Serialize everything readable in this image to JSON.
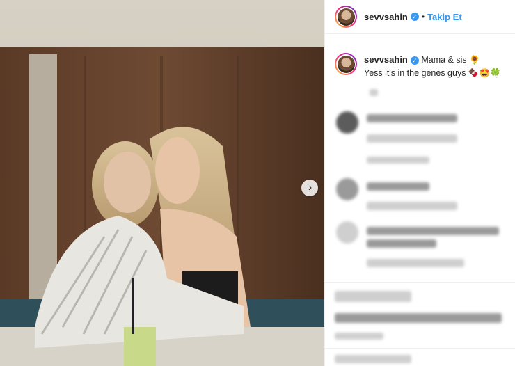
{
  "post": {
    "username": "sevvsahin",
    "follow_label": "Takip Et",
    "separator": "•",
    "caption_line1": "Mama & sis 🌻",
    "caption_line2": "Yess it's in the genes guys 🍫🤩🍀",
    "verified_mark": "✓",
    "next_icon": "›"
  },
  "colors": {
    "link_blue": "#3897f0",
    "text": "#262626",
    "border": "#efefef"
  }
}
